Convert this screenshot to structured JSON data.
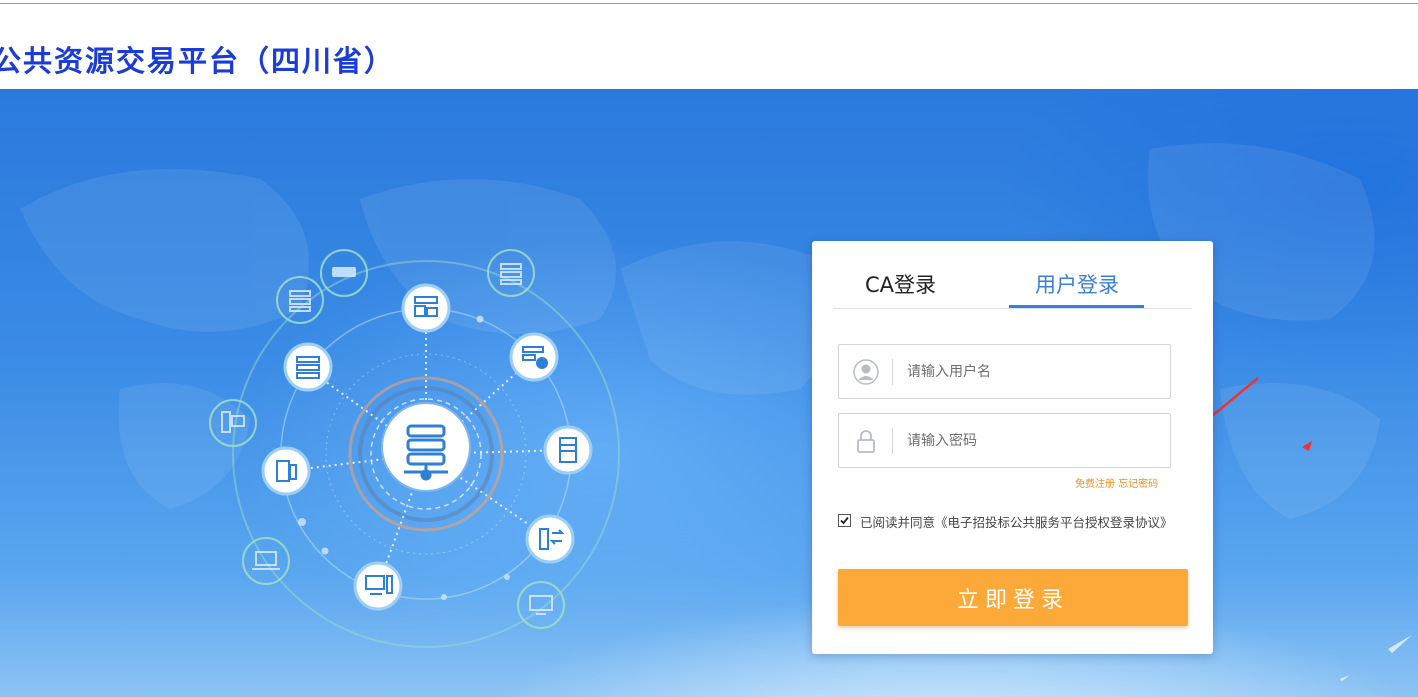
{
  "header": {
    "title": "公共资源交易平台（四川省）"
  },
  "login": {
    "tabs": [
      {
        "label": "CA登录",
        "active": false
      },
      {
        "label": "用户登录",
        "active": true
      }
    ],
    "username": {
      "placeholder": "请输入用户名",
      "value": "",
      "icon": "user-icon"
    },
    "password": {
      "placeholder": "请输入密码",
      "value": "",
      "icon": "lock-icon"
    },
    "register_link": "免费注册",
    "forgot_link": "忘记密码",
    "agree": {
      "checked": true,
      "text": "已阅读并同意《电子招投标公共服务平台授权登录协议》"
    },
    "submit_label": "立即登录"
  },
  "colors": {
    "title": "#1b3cd6",
    "active_tab": "#3a7fd5",
    "link": "#e89124",
    "button": "#fca93a",
    "annotation_arrow": "#ee3333"
  },
  "illustration": {
    "center_icon": "server-stack-icon",
    "node_icons": [
      "router-icon",
      "server-rack-icon",
      "server-window-icon",
      "server-rack-icon",
      "server-clock-icon",
      "server-rack-icon",
      "computer-tower-icon",
      "tower-pc-icon",
      "server-tower-icon",
      "server-transfer-icon",
      "laptop-icon",
      "desktop-icon",
      "monitor-icon"
    ]
  }
}
